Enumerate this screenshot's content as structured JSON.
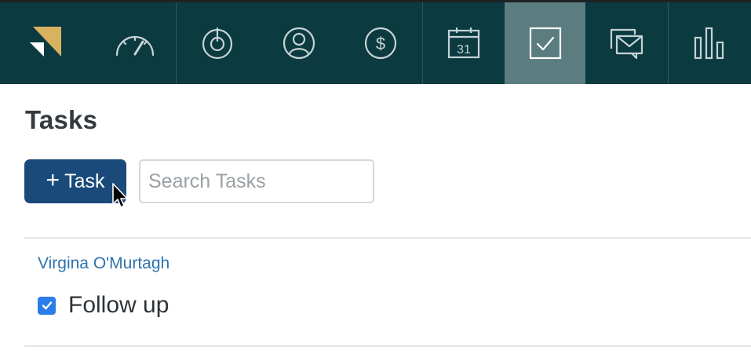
{
  "nav": {
    "items": [
      {
        "id": "dashboard",
        "icon": "speedometer-icon"
      },
      {
        "id": "leads",
        "icon": "target-icon"
      },
      {
        "id": "contacts",
        "icon": "person-icon"
      },
      {
        "id": "deals",
        "icon": "dollar-icon"
      },
      {
        "id": "calendar",
        "icon": "calendar-icon",
        "day": "31"
      },
      {
        "id": "tasks",
        "icon": "checkbox-icon",
        "active": true
      },
      {
        "id": "messages",
        "icon": "messages-icon"
      },
      {
        "id": "reports",
        "icon": "bar-chart-icon"
      }
    ],
    "active_color": "#5b7d80",
    "bar_color": "#0b3a40",
    "logo_color": "#d9b25f"
  },
  "page": {
    "title": "Tasks"
  },
  "toolbar": {
    "add_task_label": "Task",
    "search_placeholder": "Search Tasks"
  },
  "tasks": [
    {
      "contact": "Virgina O'Murtagh",
      "label": "Follow up",
      "checked": true
    }
  ]
}
